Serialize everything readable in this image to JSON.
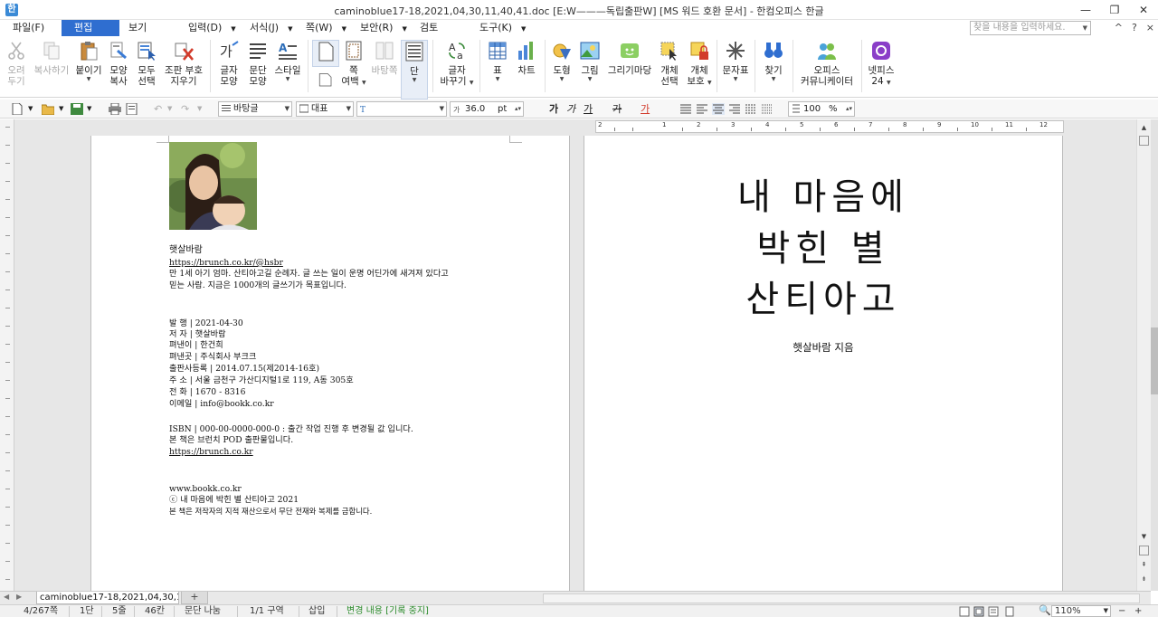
{
  "window": {
    "title": "caminoblue17-18,2021,04,30,11,40,41.doc [E:W———독립출판W] [MS 워드 호환 문서] - 한컴오피스 한글",
    "app_icon": "한",
    "controls": {
      "minimize": "—",
      "maximize": "❐",
      "close": "✕"
    }
  },
  "menu": {
    "items": [
      {
        "label": "파일(F)"
      },
      {
        "label": "편집(E)"
      },
      {
        "label": "보기(U)"
      },
      {
        "label": "입력(D)"
      },
      {
        "label": "서식(J)"
      },
      {
        "label": "쪽(W)"
      },
      {
        "label": "보안(R)"
      },
      {
        "label": "검토(H)"
      },
      {
        "label": "도구(K)"
      }
    ],
    "active_index": 1,
    "search_placeholder": "찾을 내용을 입력하세요.",
    "right_icons": {
      "collapse": "^",
      "help": "?",
      "close": "×"
    }
  },
  "ribbon": {
    "buttons": [
      {
        "label1": "오려",
        "label2": "두기",
        "icon": "scissors-icon",
        "disabled": true
      },
      {
        "label1": "복사하기",
        "label2": "",
        "icon": "copy-icon",
        "disabled": true
      },
      {
        "label1": "붙이기",
        "label2": "",
        "icon": "paste-icon",
        "disabled": false
      },
      {
        "label1": "모양",
        "label2": "복사",
        "icon": "format-painter-icon",
        "disabled": false
      },
      {
        "label1": "모두",
        "label2": "선택",
        "icon": "select-all-icon",
        "disabled": false
      },
      {
        "label1": "조판 부호",
        "label2": "지우기",
        "icon": "clear-marks-icon",
        "disabled": false
      },
      {
        "label1": "글자",
        "label2": "모양",
        "icon": "char-shape-icon",
        "disabled": false
      },
      {
        "label1": "문단",
        "label2": "모양",
        "icon": "para-shape-icon",
        "disabled": false
      },
      {
        "label1": "스타일",
        "label2": "",
        "icon": "style-icon",
        "disabled": false
      },
      {
        "label1": "",
        "label2": "",
        "icon": "page-icon",
        "disabled": false
      },
      {
        "label1": "쪽",
        "label2": "여백",
        "icon": "margin-icon",
        "disabled": false
      },
      {
        "label1": "바탕쪽",
        "label2": "",
        "icon": "master-page-icon",
        "disabled": true
      },
      {
        "label1": "단",
        "label2": "",
        "icon": "columns-icon",
        "disabled": false
      },
      {
        "label1": "글자",
        "label2": "바꾸기",
        "icon": "replace-char-icon",
        "disabled": false
      },
      {
        "label1": "표",
        "label2": "",
        "icon": "table-icon",
        "disabled": false
      },
      {
        "label1": "차트",
        "label2": "",
        "icon": "chart-icon",
        "disabled": false
      },
      {
        "label1": "도형",
        "label2": "",
        "icon": "shape-icon",
        "disabled": false
      },
      {
        "label1": "그림",
        "label2": "",
        "icon": "picture-icon",
        "disabled": false
      },
      {
        "label1": "그리기마당",
        "label2": "",
        "icon": "clipart-icon",
        "disabled": false
      },
      {
        "label1": "개체",
        "label2": "선택",
        "icon": "object-select-icon",
        "disabled": false
      },
      {
        "label1": "개체",
        "label2": "보호",
        "icon": "object-protect-icon",
        "disabled": false
      },
      {
        "label1": "문자표",
        "label2": "",
        "icon": "symbol-icon",
        "disabled": false
      },
      {
        "label1": "찾기",
        "label2": "",
        "icon": "binoculars-icon",
        "disabled": false
      },
      {
        "label1": "오피스",
        "label2": "커뮤니케이터",
        "icon": "communicator-icon",
        "disabled": false
      },
      {
        "label1": "넷피스",
        "label2": "24",
        "icon": "netffice-icon",
        "disabled": false
      }
    ]
  },
  "format_toolbar": {
    "style": "바탕글",
    "lang": "대표",
    "font": "",
    "size": "36.0",
    "unit": "pt",
    "zoom_value": "100",
    "zoom_unit": "%",
    "bold": "가",
    "italic": "가",
    "underline": "가",
    "strike": "가",
    "color": "가"
  },
  "page1": {
    "author_name": "햇살바람",
    "link1": "https://brunch.co.kr/@hsbr",
    "bio1": "만 1세 아기 엄마. 산티아고길 순례자. 글 쓰는 일이 운명 어딘가에 새겨져 있다고",
    "bio2": "믿는 사람. 지금은 1000개의 글쓰기가 목표입니다.",
    "pub_date": "발 행  |  2021-04-30",
    "writer": "저 자  |  햇살바람",
    "publisher": "펴낸이  |  한건희",
    "press": "펴낸곳  |  주식회사 부크크",
    "registration": "출판사등록  |  2014.07.15(제2014-16호)",
    "address": "주 소  |  서울 금천구 가산디지털1로 119, A동 305호",
    "phone": "전 화  |  1670 - 8316",
    "email": "이메일  |  info@bookk.co.kr",
    "isbn": "ISBN  |  000-00-0000-000-0 : 출간 작업 진행 후 변경될 값 입니다.",
    "pod": "본 책은 브런치 POD 출판물입니다.",
    "link2": "https://brunch.co.kr",
    "site": "www.bookk.co.kr",
    "copyright": "ⓒ 내 마음에 박힌 별 산티아고 2021",
    "rights": "본 책은 저작자의 지적 재산으로서 무단 전재와 복제를 금합니다."
  },
  "page2": {
    "title_lines": [
      "내 마음에",
      "박힌 별",
      "산티아고"
    ],
    "author_line": "햇살바람 지음"
  },
  "ruler_numbers": [
    "2",
    "1",
    "2",
    "3",
    "4",
    "5",
    "6",
    "7",
    "8",
    "9",
    "10",
    "11",
    "12"
  ],
  "tabs": {
    "document_tab": "caminoblue17-18,2021,04,30,11,...",
    "add_tab": "+"
  },
  "status": {
    "page": "4/267쪽",
    "column": "1단",
    "line": "5줄",
    "col": "46칸",
    "word_wrap": "문단 나눔",
    "section": "1/1 구역",
    "mode": "삽입",
    "track": "변경 내용 [기록 중지]",
    "zoom": "110%"
  },
  "colors": {
    "accent": "#2f6ed0",
    "status_green": "#2a8a2a"
  }
}
